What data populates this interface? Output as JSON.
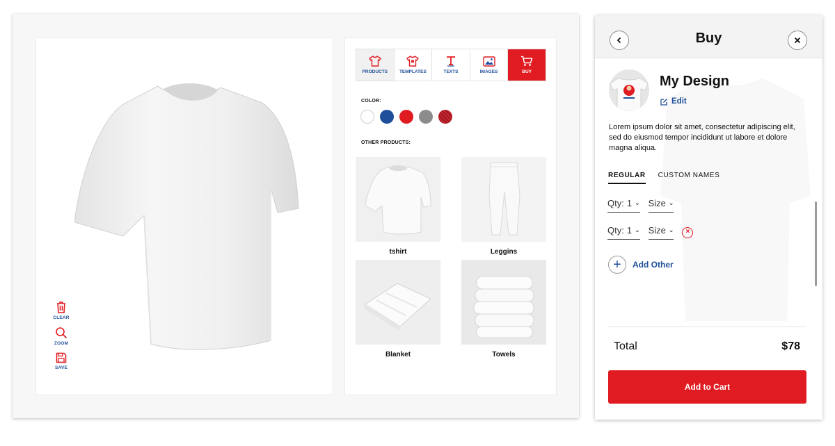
{
  "canvas": {
    "tools": [
      {
        "label": "CLEAR",
        "icon": "trash-icon"
      },
      {
        "label": "ZOOM",
        "icon": "magnifier-icon"
      },
      {
        "label": "SAVE",
        "icon": "floppy-icon"
      }
    ]
  },
  "tabs": [
    {
      "label": "PRODUCTS",
      "icon": "tshirt-icon"
    },
    {
      "label": "TEMPLATES",
      "icon": "tshirt-template-icon"
    },
    {
      "label": "TEXTS",
      "icon": "text-icon"
    },
    {
      "label": "IMAGES",
      "icon": "image-icon"
    },
    {
      "label": "BUY",
      "icon": "cart-icon"
    }
  ],
  "color_section": {
    "label": "COLOR:",
    "swatches": [
      "#ffffff",
      "#1f4f9a",
      "#e01b22",
      "#8c8c8c",
      "#a3141d"
    ]
  },
  "other_products": {
    "label": "OTHER PRODUCTS:",
    "items": [
      {
        "name": "tshirt"
      },
      {
        "name": "Leggins"
      },
      {
        "name": "Blanket"
      },
      {
        "name": "Towels"
      }
    ]
  },
  "buy": {
    "title": "Buy",
    "design_name": "My Design",
    "edit_label": "Edit",
    "description": "Lorem ipsum dolor sit amet, consectetur adipiscing elit, sed do eiusmod tempor incididunt ut labore et dolore magna aliqua.",
    "tabs": [
      "REGULAR",
      "CUSTOM NAMES"
    ],
    "rows": [
      {
        "qty_label": "Qty:",
        "qty": "1",
        "size_label": "Size"
      },
      {
        "qty_label": "Qty:",
        "qty": "1",
        "size_label": "Size"
      }
    ],
    "add_other_label": "Add Other",
    "total_label": "Total",
    "total_value": "$78",
    "add_to_cart_label": "Add to Cart"
  },
  "colors": {
    "accent_red": "#e01b22",
    "accent_blue": "#1f4f9a"
  }
}
